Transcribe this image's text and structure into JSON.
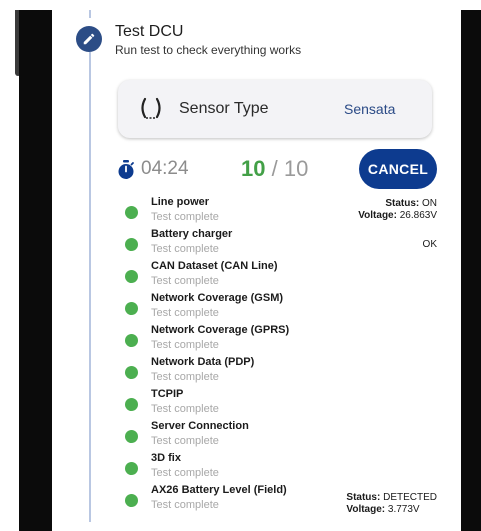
{
  "step": {
    "title": "Test DCU",
    "subtitle": "Run test to check everything works",
    "badge_icon": "pencil-icon",
    "accent_color": "#2c4d86"
  },
  "sensor": {
    "label": "Sensor Type",
    "value": "Sensata",
    "icon": "tire-pressure-icon"
  },
  "progress": {
    "timer": "04:24",
    "done": "10",
    "separator": "/",
    "total": "10",
    "cancel_label": "CANCEL",
    "button_color": "#0d3b8f",
    "done_color": "#43a047"
  },
  "tests": [
    {
      "name": "Line power",
      "status": "Test complete",
      "right": [
        {
          "key": "Status:",
          "value": "ON"
        },
        {
          "key": "Voltage:",
          "value": "26.863V"
        }
      ]
    },
    {
      "name": "Battery charger",
      "status": "Test complete",
      "right_plain": "OK"
    },
    {
      "name": "CAN Dataset (CAN Line)",
      "status": "Test complete"
    },
    {
      "name": "Network Coverage (GSM)",
      "status": "Test complete"
    },
    {
      "name": "Network Coverage (GPRS)",
      "status": "Test complete"
    },
    {
      "name": "Network Data (PDP)",
      "status": "Test complete"
    },
    {
      "name": "TCPIP",
      "status": "Test complete"
    },
    {
      "name": "Server Connection",
      "status": "Test complete"
    },
    {
      "name": "3D fix",
      "status": "Test complete"
    },
    {
      "name": "AX26 Battery Level (Field)",
      "status": "Test complete",
      "right": [
        {
          "key": "Status:",
          "value": "DETECTED"
        },
        {
          "key": "Voltage:",
          "value": "3.773V"
        }
      ]
    }
  ],
  "status_dot_color": "#4caf50"
}
